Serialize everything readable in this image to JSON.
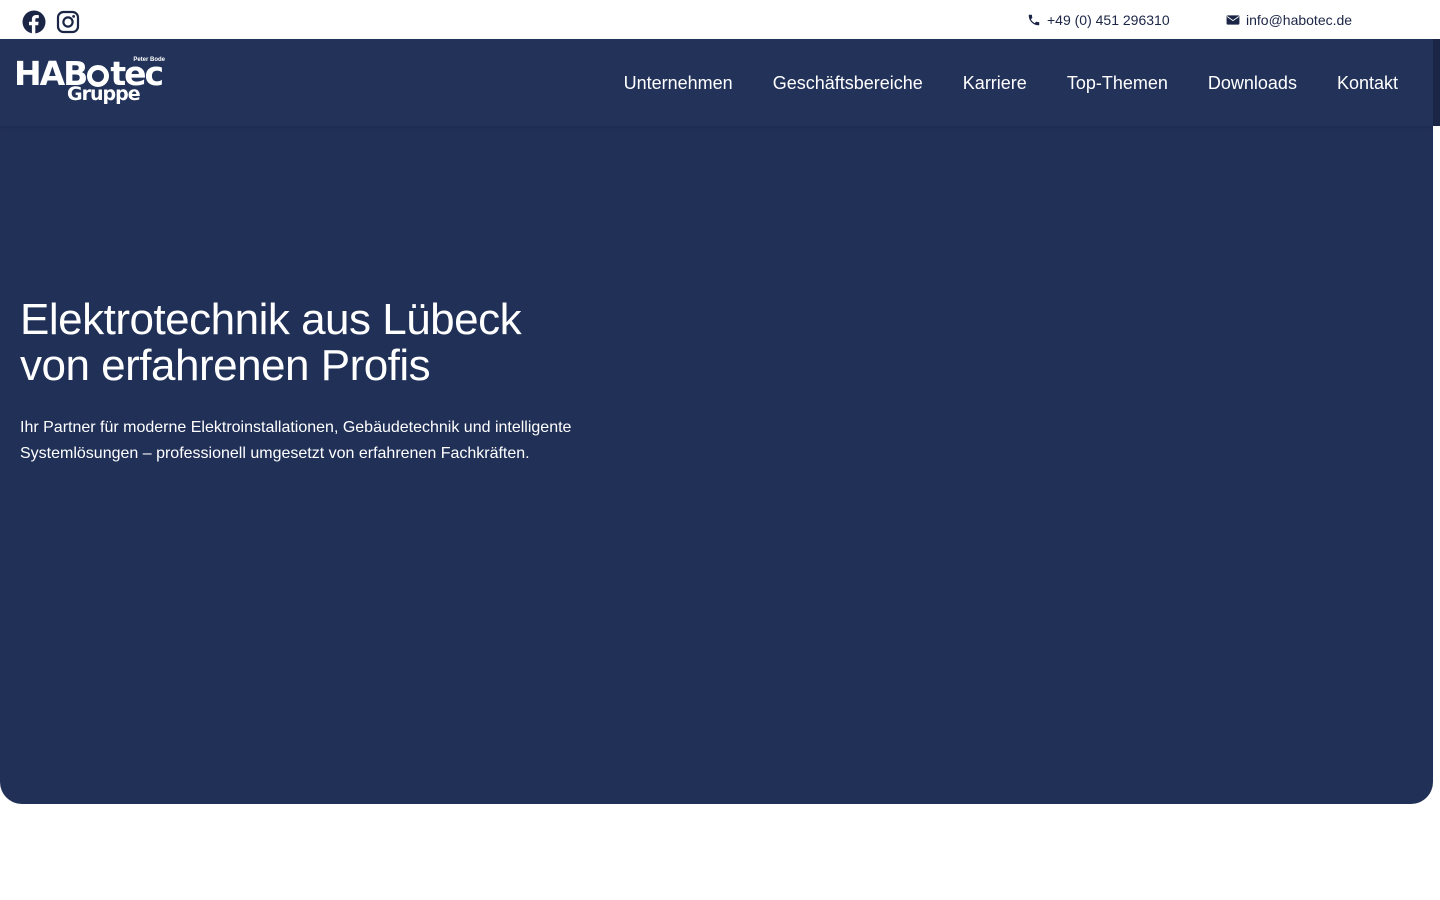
{
  "topbar": {
    "phone": "+49 (0) 451 296310",
    "email": "info@habotec.de",
    "social": [
      "facebook-icon",
      "instagram-icon"
    ]
  },
  "logo": {
    "main_left": "HAB",
    "main_right": "tec",
    "sub": "Gruppe",
    "tag": "Peter Bode"
  },
  "nav": {
    "items": [
      {
        "label": "Unternehmen"
      },
      {
        "label": "Geschäftsbereiche"
      },
      {
        "label": "Karriere"
      },
      {
        "label": "Top-Themen"
      },
      {
        "label": "Downloads"
      },
      {
        "label": "Kontakt"
      }
    ]
  },
  "hero": {
    "headline_line1": "Elektrotechnik aus Lübeck",
    "headline_line2": "von erfahrenen Profis",
    "subline": "Ihr Partner für moderne Elektroinstallationen, Gebäudetechnik und intelligente Systemlösungen – professionell umgesetzt von erfahrenen Fachkräften."
  },
  "colors": {
    "hero_bg": "#213057",
    "nav_bg": "#223259",
    "text_dark": "#1b2546",
    "text_light": "#ffffff"
  }
}
